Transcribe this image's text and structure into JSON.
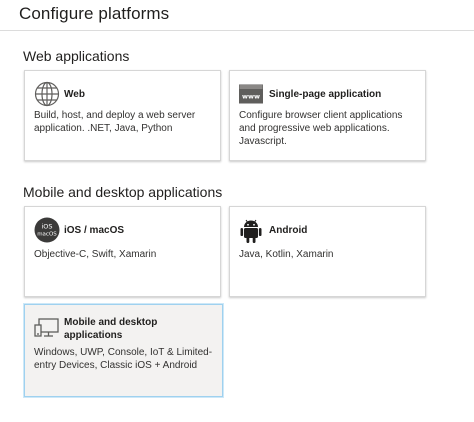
{
  "page": {
    "title": "Configure platforms"
  },
  "sections": {
    "web": {
      "title": "Web applications",
      "cards": {
        "web": {
          "title": "Web",
          "description": "Build, host, and deploy a web server application. .NET, Java, Python",
          "icon": "globe-icon"
        },
        "spa": {
          "title": "Single-page application",
          "description": "Configure browser client applications and progressive web applications. Javascript.",
          "icon": "www-window-icon"
        }
      }
    },
    "mobile": {
      "title": "Mobile and desktop applications",
      "cards": {
        "ios": {
          "title": "iOS / macOS",
          "description": "Objective-C, Swift, Xamarin",
          "icon": "ios-macos-icon",
          "icon_text_top": "iOS",
          "icon_text_bottom": "macOS"
        },
        "android": {
          "title": "Android",
          "description": "Java, Kotlin, Xamarin",
          "icon": "android-icon"
        },
        "desktop": {
          "title": "Mobile and desktop applications",
          "description": "Windows, UWP, Console, IoT & Limited-entry Devices, Classic iOS + Android",
          "icon": "desktop-mobile-icon",
          "selected": true
        }
      }
    }
  },
  "colors": {
    "selected_border": "#9fd1ef",
    "selected_bg": "#f3f2f1",
    "ios_icon_bg": "#3b3a39"
  }
}
